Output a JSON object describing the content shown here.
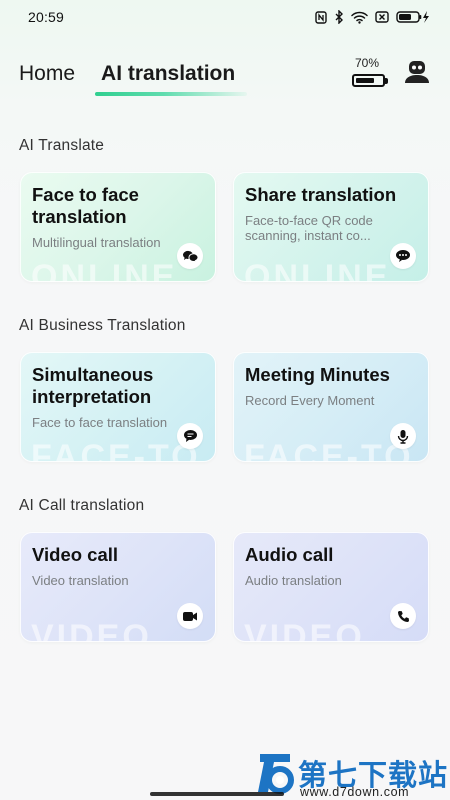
{
  "status_bar": {
    "time": "20:59",
    "icons": [
      "nfc-icon",
      "bluetooth-icon",
      "wifi-icon",
      "sim-off-icon",
      "battery-charging-icon"
    ]
  },
  "nav": {
    "tabs": [
      {
        "label": "Home",
        "active": false
      },
      {
        "label": "AI translation",
        "active": true
      }
    ],
    "device_battery": {
      "label": "70%",
      "level": 0.7
    },
    "robot_icon": "robot-icon"
  },
  "sections": [
    {
      "title": "AI Translate",
      "cards": [
        {
          "title": "Face to face translation",
          "subtitle": "Multilingual translation",
          "watermark": "ONLINE",
          "icon": "chat-bubbles-icon"
        },
        {
          "title": "Share translation",
          "subtitle": "Face-to-face QR code scanning, instant co...",
          "watermark": "ONLINE",
          "icon": "share-chat-icon"
        }
      ]
    },
    {
      "title": "AI Business Translation",
      "cards": [
        {
          "title": "Simultaneous interpretation",
          "subtitle": "Face to face translation",
          "watermark": "FACE-TO",
          "icon": "message-icon"
        },
        {
          "title": "Meeting Minutes",
          "subtitle": "Record Every Moment",
          "watermark": "FACE-TO",
          "icon": "microphone-icon"
        }
      ]
    },
    {
      "title": "AI Call translation",
      "cards": [
        {
          "title": "Video call",
          "subtitle": "Video translation",
          "watermark": "VIDEO",
          "icon": "video-camera-icon"
        },
        {
          "title": "Audio call",
          "subtitle": "Audio translation",
          "watermark": "VIDEO",
          "icon": "phone-icon"
        }
      ]
    }
  ],
  "watermark": {
    "name": "第七下载站",
    "url": "www.d7down.com",
    "brand_color": "#1d74c4"
  },
  "colors": {
    "accent": "#2fcf8f",
    "text_primary": "#111111",
    "text_secondary": "#7b7f82"
  }
}
